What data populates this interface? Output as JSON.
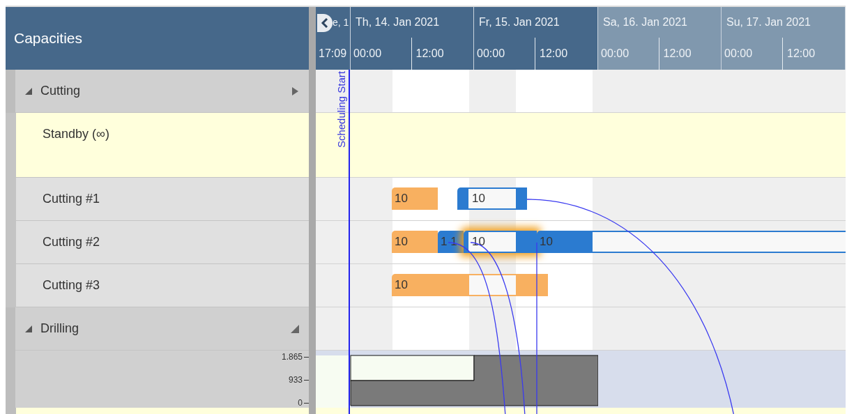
{
  "panel_title": "Capacities",
  "days": [
    {
      "label": "e, 1",
      "weekend": false,
      "hours": [
        "17:09"
      ]
    },
    {
      "label": "Th, 14. Jan 2021",
      "weekend": false,
      "hours": [
        "00:00",
        "12:00"
      ]
    },
    {
      "label": "Fr, 15. Jan 2021",
      "weekend": false,
      "hours": [
        "00:00",
        "12:00"
      ]
    },
    {
      "label": "Sa, 16. Jan 2021",
      "weekend": true,
      "hours": [
        "00:00",
        "12:00"
      ]
    },
    {
      "label": "Su, 17. Jan 2021",
      "weekend": true,
      "hours": [
        "00:00",
        "12:00"
      ]
    }
  ],
  "scheduling_start": "Scheduling Start",
  "groups": [
    {
      "name": "Cutting",
      "expanded": true,
      "rows": [
        {
          "name": "Standby (∞)",
          "kind": "standby",
          "bars": []
        },
        {
          "name": "Cutting #1",
          "kind": "machine",
          "bars": [
            {
              "label": "10",
              "kind": "pending",
              "selected": false
            },
            {
              "label": "10",
              "kind": "scheduled",
              "selected": false
            }
          ]
        },
        {
          "name": "Cutting #2",
          "kind": "machine",
          "bars": [
            {
              "label": "10",
              "kind": "pending",
              "selected": false
            },
            {
              "label": "1 1",
              "kind": "scheduled",
              "selected": false
            },
            {
              "label": "10",
              "kind": "scheduled",
              "selected": true
            },
            {
              "label": "10",
              "kind": "scheduled",
              "selected": false
            }
          ]
        },
        {
          "name": "Cutting #3",
          "kind": "machine",
          "bars": [
            {
              "label": "10",
              "kind": "pending",
              "selected": false
            }
          ]
        }
      ]
    },
    {
      "name": "Drilling",
      "expanded": true,
      "load_axis": [
        "1.865",
        "933",
        "0"
      ]
    }
  ]
}
